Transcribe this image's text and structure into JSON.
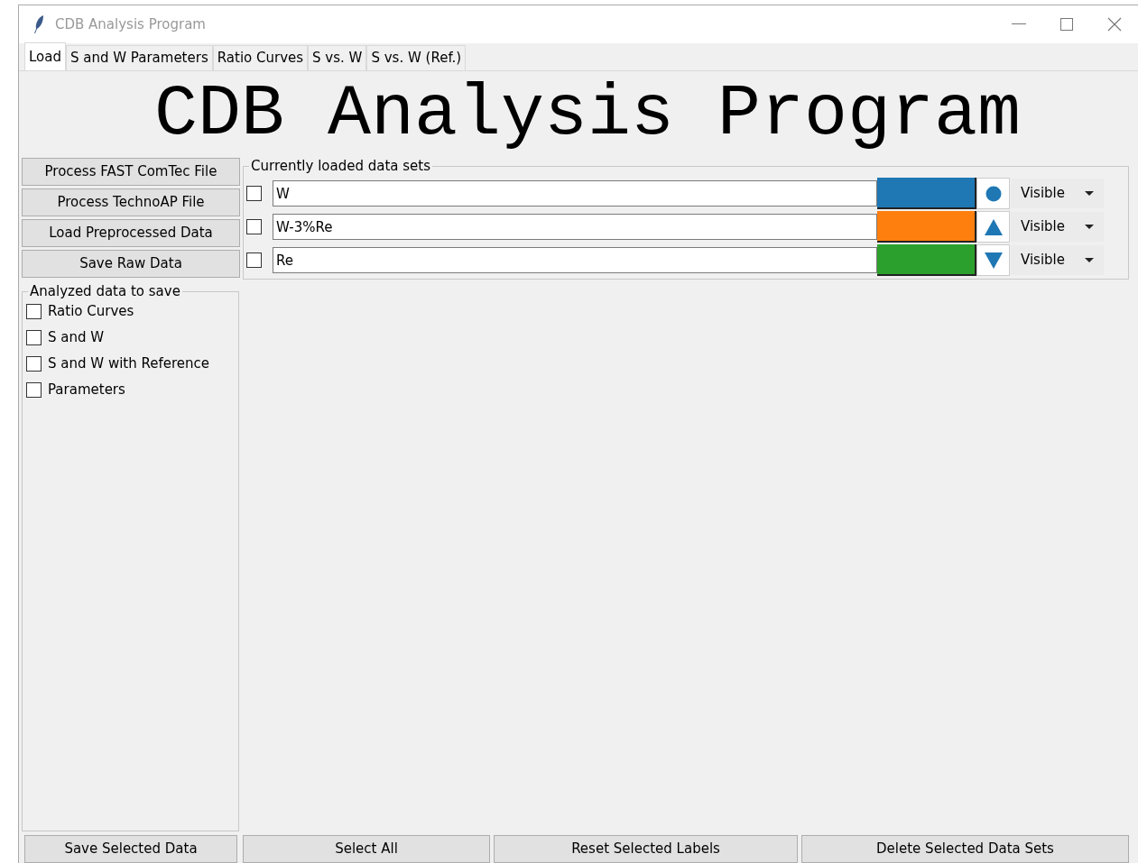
{
  "window": {
    "title": "CDB Analysis Program"
  },
  "tabs": [
    {
      "label": "Load",
      "selected": true
    },
    {
      "label": "S and W Parameters",
      "selected": false
    },
    {
      "label": "Ratio Curves",
      "selected": false
    },
    {
      "label": "S vs. W",
      "selected": false
    },
    {
      "label": "S vs. W (Ref.)",
      "selected": false
    }
  ],
  "heading": "CDB Analysis Program",
  "actions": [
    "Process FAST ComTec File",
    "Process TechnoAP File",
    "Load Preprocessed Data",
    "Save Raw Data"
  ],
  "save_group": {
    "title": "Analyzed data to save",
    "options": [
      {
        "label": "Ratio Curves",
        "checked": false
      },
      {
        "label": "S and W",
        "checked": false
      },
      {
        "label": "S and W with Reference",
        "checked": false
      },
      {
        "label": "Parameters",
        "checked": false
      }
    ],
    "button": "Save Selected Data"
  },
  "datasets": {
    "title": "Currently loaded data sets",
    "rows": [
      {
        "checked": false,
        "name": "W",
        "color": "#1f77b4",
        "marker": {
          "kind": "circle"
        },
        "visibility": "Visible"
      },
      {
        "checked": false,
        "name": "W-3%Re",
        "color": "#ff7f0e",
        "marker": {
          "kind": "triangle-up"
        },
        "visibility": "Visible"
      },
      {
        "checked": false,
        "name": "Re",
        "color": "#2ca02c",
        "marker": {
          "kind": "triangle-down"
        },
        "visibility": "Visible"
      }
    ]
  },
  "bottom_buttons": [
    "Select All",
    "Reset Selected Labels",
    "Delete Selected Data Sets"
  ]
}
